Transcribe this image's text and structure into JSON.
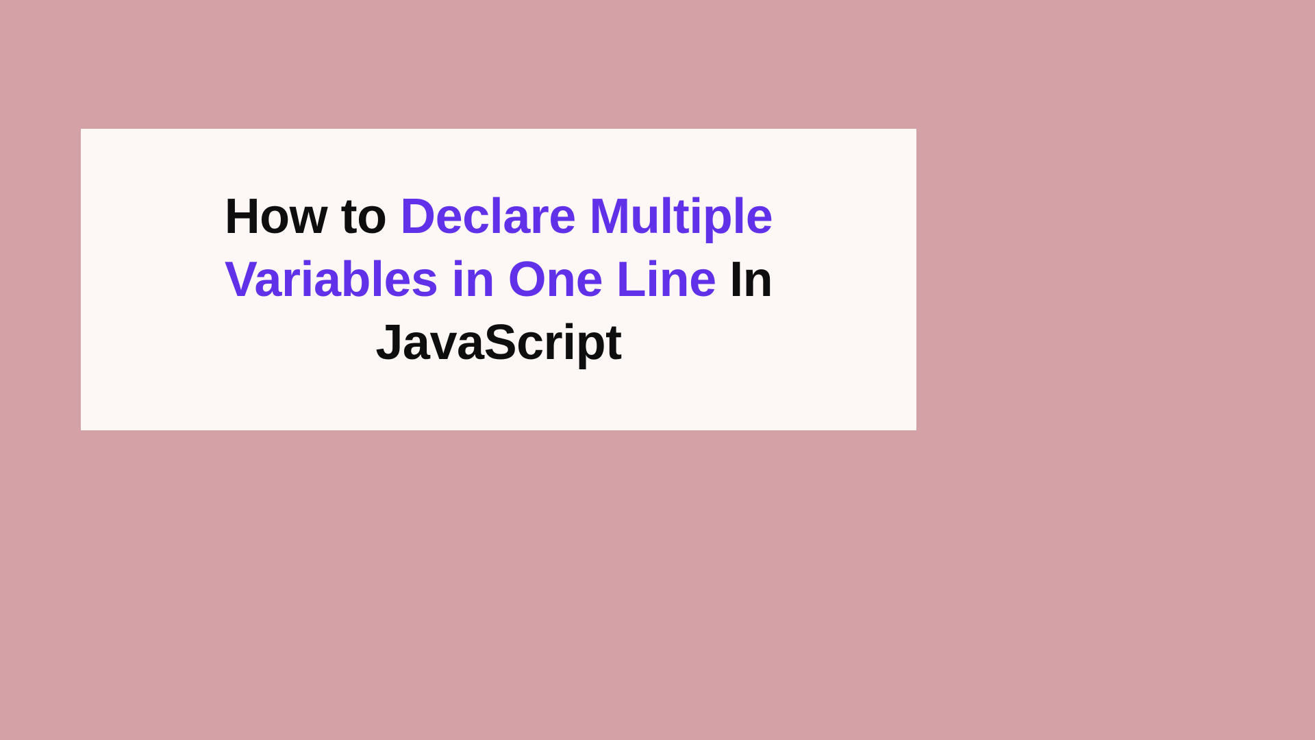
{
  "heading": {
    "part1": "How to ",
    "accent1": "Declare Multiple",
    "accent2": "Variables in One Line",
    "part2": " In",
    "part3": "JavaScript"
  }
}
